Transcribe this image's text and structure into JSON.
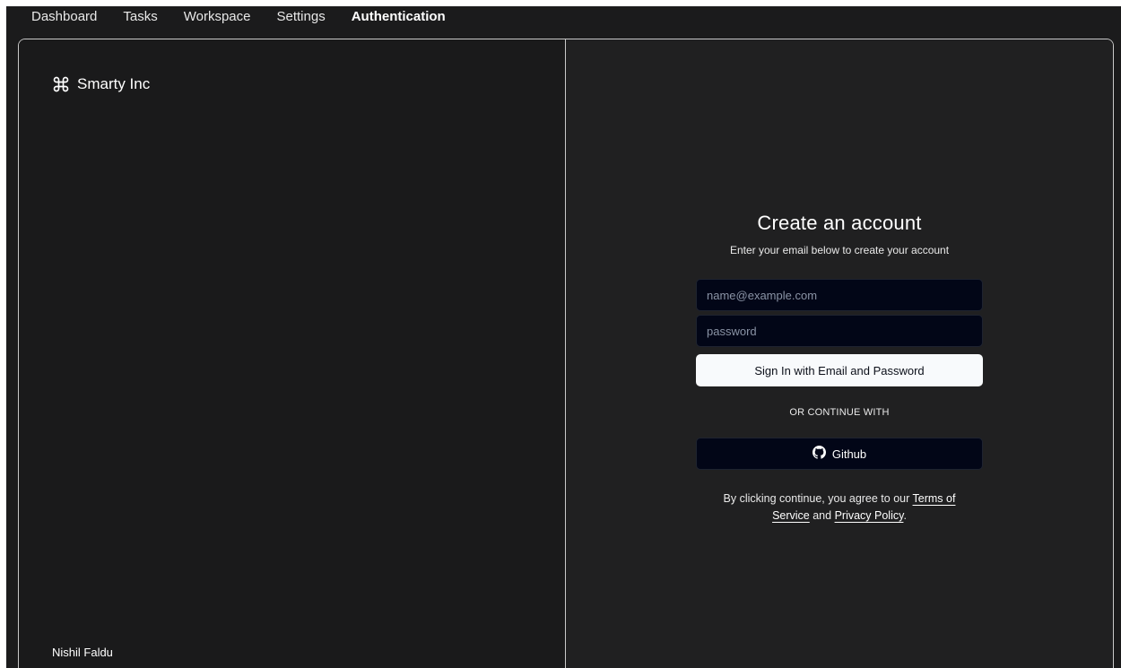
{
  "nav": {
    "items": [
      {
        "label": "Dashboard"
      },
      {
        "label": "Tasks"
      },
      {
        "label": "Workspace"
      },
      {
        "label": "Settings"
      },
      {
        "label": "Authentication",
        "active": true
      }
    ]
  },
  "brand": {
    "icon": "command-icon",
    "name": "Smarty Inc"
  },
  "footer": {
    "author": "Nishil Faldu"
  },
  "form": {
    "title": "Create an account",
    "subtitle": "Enter your email below to create your account",
    "email_placeholder": "name@example.com",
    "password_placeholder": "password",
    "submit_label": "Sign In with Email and Password",
    "divider_label": "OR CONTINUE WITH",
    "github_label": "Github",
    "github_icon": "github-icon"
  },
  "terms": {
    "prefix": "By clicking continue, you agree to our ",
    "terms_link": "Terms of Service",
    "middle": " and ",
    "privacy_link": "Privacy Policy",
    "suffix": "."
  },
  "colors": {
    "left_bg": "#1a1a1b",
    "right_bg": "#202021",
    "input_bg": "#020617",
    "primary_btn": "#f8fafc"
  }
}
